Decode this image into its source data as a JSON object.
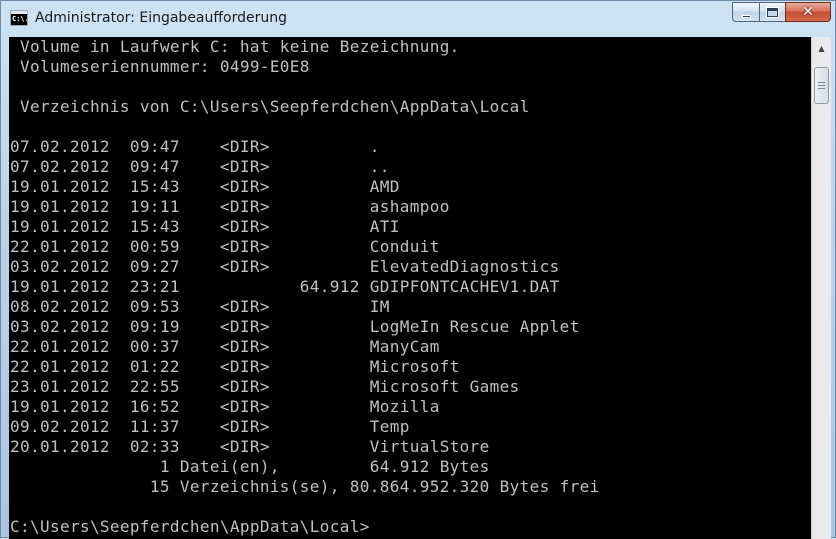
{
  "window": {
    "title": "Administrator: Eingabeaufforderung",
    "icon_text": "C:\\.",
    "controls": {
      "minimize": "minimize",
      "maximize": "maximize",
      "close": "✕"
    }
  },
  "console": {
    "lines": [
      " Volume in Laufwerk C: hat keine Bezeichnung.",
      " Volumeseriennummer: 0499-E0E8",
      "",
      " Verzeichnis von C:\\Users\\Seepferdchen\\AppData\\Local",
      "",
      "07.02.2012  09:47    <DIR>          .",
      "07.02.2012  09:47    <DIR>          ..",
      "19.01.2012  15:43    <DIR>          AMD",
      "19.01.2012  19:11    <DIR>          ashampoo",
      "19.01.2012  15:43    <DIR>          ATI",
      "22.01.2012  00:59    <DIR>          Conduit",
      "03.02.2012  09:27    <DIR>          ElevatedDiagnostics",
      "19.01.2012  23:21            64.912 GDIPFONTCACHEV1.DAT",
      "08.02.2012  09:53    <DIR>          IM",
      "03.02.2012  09:19    <DIR>          LogMeIn Rescue Applet",
      "22.01.2012  00:37    <DIR>          ManyCam",
      "22.01.2012  01:22    <DIR>          Microsoft",
      "23.01.2012  22:55    <DIR>          Microsoft Games",
      "19.01.2012  16:52    <DIR>          Mozilla",
      "09.02.2012  11:37    <DIR>          Temp",
      "20.01.2012  02:33    <DIR>          VirtualStore",
      "               1 Datei(en),         64.912 Bytes",
      "              15 Verzeichnis(se), 80.864.952.320 Bytes frei",
      "",
      "C:\\Users\\Seepferdchen\\AppData\\Local>"
    ]
  },
  "scrollbar": {
    "up_arrow": "▲"
  },
  "colors": {
    "console_bg": "#000000",
    "console_text": "#c0c0c0",
    "close_button": "#c34b32"
  }
}
